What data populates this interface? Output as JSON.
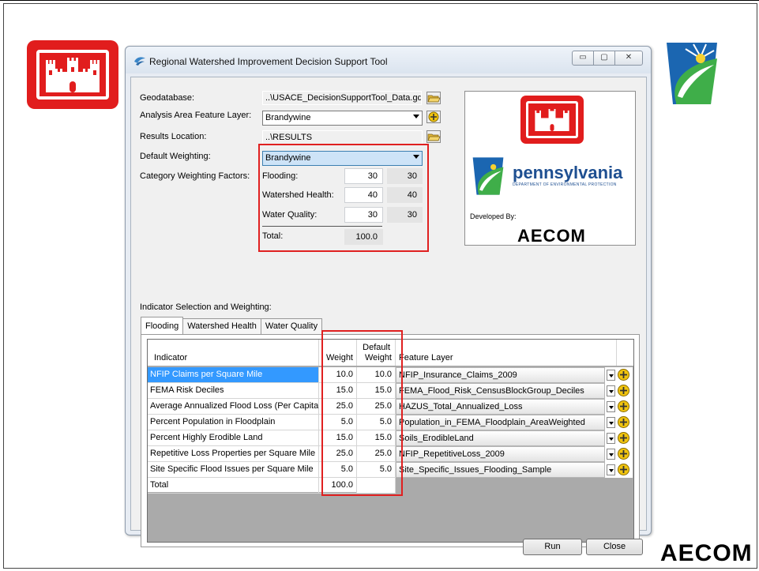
{
  "window": {
    "title": "Regional Watershed Improvement Decision Support Tool",
    "controls": [
      "minimize",
      "restore",
      "close"
    ]
  },
  "form": {
    "geodatabase": {
      "label": "Geodatabase:",
      "value": "..\\USACE_DecisionSupportTool_Data.gdb"
    },
    "analysis_layer": {
      "label": "Analysis Area Feature Layer:",
      "value": "Brandywine"
    },
    "results_location": {
      "label": "Results Location:",
      "value": "..\\RESULTS"
    },
    "default_weighting": {
      "label": "Default Weighting:",
      "value": "Brandywine"
    },
    "category_weighting": {
      "label": "Category Weighting Factors:",
      "rows": [
        {
          "label": "Flooding:",
          "value": "30",
          "default": "30"
        },
        {
          "label": "Watershed Health:",
          "value": "40",
          "default": "40"
        },
        {
          "label": "Water Quality:",
          "value": "30",
          "default": "30"
        }
      ],
      "total_label": "Total:",
      "total_value": "100.0"
    }
  },
  "info_panel": {
    "pa_name": "pennsylvania",
    "pa_sub": "DEPARTMENT OF ENVIRONMENTAL PROTECTION",
    "developed_by": "Developed By:",
    "developer": "AECOM"
  },
  "indicator_section": {
    "label": "Indicator Selection and Weighting:",
    "tabs": [
      "Flooding",
      "Watershed Health",
      "Water Quality"
    ],
    "active_tab": "Flooding",
    "columns": {
      "indicator": "Indicator",
      "weight": "Weight",
      "default_weight_1": "Default",
      "default_weight_2": "Weight",
      "feature_layer": "Feature Layer"
    },
    "rows": [
      {
        "indicator": "NFIP Claims per Square Mile",
        "weight": "10.0",
        "default": "10.0",
        "layer": "NFIP_Insurance_Claims_2009",
        "selected": true
      },
      {
        "indicator": "FEMA Risk Deciles",
        "weight": "15.0",
        "default": "15.0",
        "layer": "FEMA_Flood_Risk_CensusBlockGroup_Deciles",
        "selected": false
      },
      {
        "indicator": "Average Annualized Flood Loss (Per Capita)",
        "weight": "25.0",
        "default": "25.0",
        "layer": "HAZUS_Total_Annualized_Loss",
        "selected": false
      },
      {
        "indicator": "Percent Population in Floodplain",
        "weight": "5.0",
        "default": "5.0",
        "layer": "Population_in_FEMA_Floodplain_AreaWeighted",
        "selected": false
      },
      {
        "indicator": "Percent Highly Erodible Land",
        "weight": "15.0",
        "default": "15.0",
        "layer": "Soils_ErodibleLand",
        "selected": false
      },
      {
        "indicator": "Repetitive Loss Properties per Square Mile",
        "weight": "25.0",
        "default": "25.0",
        "layer": "NFIP_RepetitiveLoss_2009",
        "selected": false
      },
      {
        "indicator": "Site Specific Flood Issues per Square Mile",
        "weight": "5.0",
        "default": "5.0",
        "layer": "Site_Specific_Issues_Flooding_Sample",
        "selected": false
      }
    ],
    "total": {
      "label": "Total",
      "weight": "100.0"
    }
  },
  "buttons": {
    "run": "Run",
    "close": "Close"
  },
  "slide": {
    "footer_logo": "AECOM"
  },
  "colors": {
    "usace_red": "#e11d1d",
    "highlight_red": "#e02020",
    "selection_blue": "#3399ff"
  }
}
